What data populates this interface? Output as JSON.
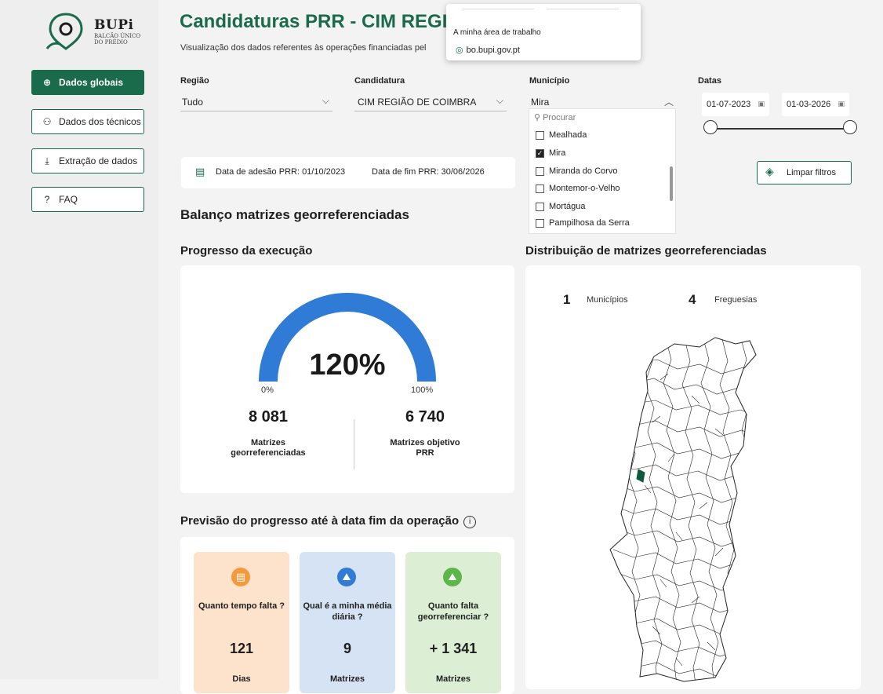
{
  "app": {
    "logo_title": "BUPi",
    "logo_subtitle": "BALCÃO ÚNICO DO PRÉDIO"
  },
  "sidebar": {
    "items": [
      {
        "label": "Dados globais",
        "icon": "globe-icon",
        "active": true
      },
      {
        "label": "Dados dos técnicos",
        "icon": "users-icon",
        "active": false
      },
      {
        "label": "Extração de dados",
        "icon": "download-icon",
        "active": false
      },
      {
        "label": "FAQ",
        "icon": "question-icon",
        "active": false
      }
    ]
  },
  "header": {
    "title": "Candidaturas PRR - CIM REGIÃ",
    "subtitle": "Visualização dos dados referentes às operações financiadas pel"
  },
  "popup": {
    "line1": "A minha área de trabalho",
    "line2": "bo.bupi.gov.pt"
  },
  "filters": {
    "region": {
      "label": "Região",
      "value": "Tudo"
    },
    "candidatura": {
      "label": "Candidatura",
      "value": "CIM REGIÃO DE COIMBRA"
    },
    "municipio": {
      "label": "Município",
      "value": "Mira",
      "search_placeholder": "Procurar",
      "options": [
        {
          "label": "Mealhada",
          "checked": false
        },
        {
          "label": "Mira",
          "checked": true
        },
        {
          "label": "Miranda do Corvo",
          "checked": false
        },
        {
          "label": "Montemor-o-Velho",
          "checked": false
        },
        {
          "label": "Mortágua",
          "checked": false
        },
        {
          "label": "Pampilhosa da Serra",
          "checked": false
        }
      ]
    },
    "datas": {
      "label": "Datas",
      "start": "01-07-2023",
      "end": "01-03-2026"
    }
  },
  "date_info": {
    "adesao": "Data de adesão PRR: 01/10/2023",
    "fim": "Data de fim PRR: 30/06/2026"
  },
  "clear_filters_label": "Limpar filtros",
  "sections": {
    "balanco": "Balanço matrizes georreferenciadas",
    "progresso": "Progresso da execução",
    "distribuicao": "Distribuição de matrizes georreferenciadas",
    "previsao": "Previsão do progresso até à data fim da operação"
  },
  "gauge": {
    "percent_label": "120%",
    "fill_fraction": 1.0,
    "min_label": "0%",
    "max_label": "100%",
    "left_value": "8 081",
    "left_label": "Matrizes georreferenciadas",
    "right_value": "6 740",
    "right_label": "Matrizes objetivo PRR",
    "color": "#2f7bd6"
  },
  "forecast": [
    {
      "question": "Quanto tempo falta ?",
      "value": "121",
      "unit": "Dias",
      "bg": "#fde2cc",
      "badge": "#f39a3d",
      "icon": "calendar-icon"
    },
    {
      "question": "Qual é a minha média diária ?",
      "value": "9",
      "unit": "Matrizes",
      "bg": "#d6e3f5",
      "badge": "#2f7bd6",
      "icon": "map-user-icon"
    },
    {
      "question": "Quanto falta georreferenciar ?",
      "value": "+ 1 341",
      "unit": "Matrizes",
      "bg": "#dcefd5",
      "badge": "#5cb64a",
      "icon": "map-user-icon"
    }
  ],
  "map": {
    "municipios_count": "1",
    "municipios_label": "Municípios",
    "freguesias_count": "4",
    "freguesias_label": "Freguesias",
    "highlight_color": "#0f5a3c"
  }
}
